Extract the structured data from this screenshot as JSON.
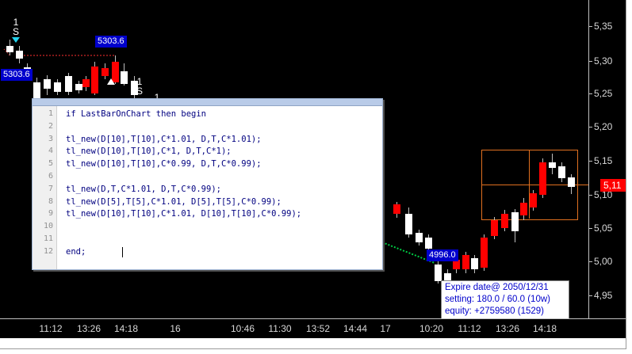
{
  "price_axis": {
    "labels": [
      "5,35",
      "5,30",
      "5,25",
      "5,20",
      "5,15",
      "5,10",
      "5,05",
      "5,00",
      "4,95"
    ],
    "current_price_label": "5,11",
    "current_price_color": "#ff0000"
  },
  "time_axis": {
    "labels": [
      "11:12",
      "13:26",
      "14:18",
      "16",
      "10:46",
      "11:30",
      "13:52",
      "14:44",
      "17",
      "10:20",
      "11:12",
      "13:26",
      "14:18"
    ]
  },
  "annotations": {
    "tag_top": "5303.6",
    "tag_left": "5303.6",
    "tag_bottom": "4996.0",
    "signal_top_left_num": "1",
    "signal_top_left_letter": "S",
    "signal_mid_num": "1",
    "signal_mid_letter": "S",
    "signal_mid_cut": "1"
  },
  "editor": {
    "lines": [
      {
        "num": "1",
        "text": "if LastBarOnChart then begin"
      },
      {
        "num": "2",
        "text": ""
      },
      {
        "num": "3",
        "text": "tl_new(D[10],T[10],C*1.01, D,T,C*1.01);"
      },
      {
        "num": "4",
        "text": "tl_new(D[10],T[10],C*1, D,T,C*1);"
      },
      {
        "num": "5",
        "text": "tl_new(D[10],T[10],C*0.99, D,T,C*0.99);"
      },
      {
        "num": "6",
        "text": ""
      },
      {
        "num": "7",
        "text": "tl_new(D,T,C*1.01, D,T,C*0.99);"
      },
      {
        "num": "8",
        "text": "tl_new(D[5],T[5],C*1.01, D[5],T[5],C*0.99);"
      },
      {
        "num": "9",
        "text": "tl_new(D[10],T[10],C*1.01, D[10],T[10],C*0.99);"
      },
      {
        "num": "10",
        "text": ""
      },
      {
        "num": "11",
        "text": ""
      },
      {
        "num": "12",
        "text": "end;"
      }
    ]
  },
  "info_box": {
    "line1": "Expire date@ 2050/12/31",
    "line2": "setting: 180.0 / 60.0 (10w)",
    "line3": "equity: +2759580 (1529)"
  },
  "colors": {
    "background": "#000000",
    "bear_candle": "#ff0000",
    "bull_candle": "#ffffff",
    "box_lines": "#e07020",
    "tag": "#0000cc",
    "dotted_line": "#00cc44"
  }
}
